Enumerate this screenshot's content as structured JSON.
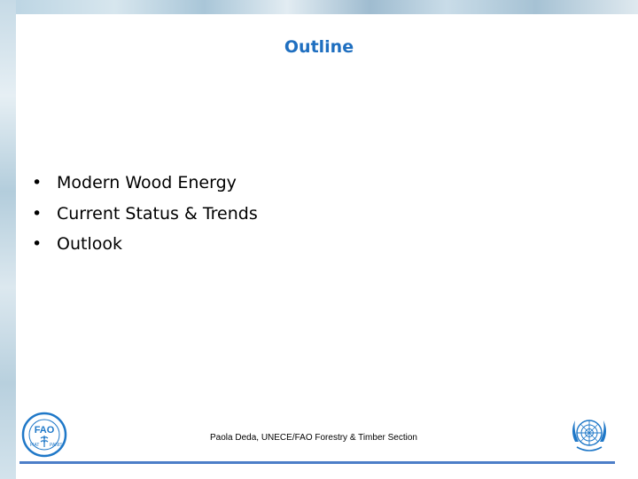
{
  "slide": {
    "title": "Outline",
    "bullets": [
      {
        "marker": "•",
        "text": "Modern Wood Energy"
      },
      {
        "marker": "•",
        "text": "Current Status & Trends"
      },
      {
        "marker": "•",
        "text": "Outlook"
      }
    ],
    "footer_text": "Paola Deda, UNECE/FAO Forestry & Timber Section",
    "logos": {
      "left": {
        "name": "fao-logo-icon",
        "lettering": "FAO FIAT PANIS"
      },
      "right": {
        "name": "un-emblem-icon"
      }
    }
  },
  "colors": {
    "title": "#1f6fc0",
    "footer_rule": "#4d7ec8",
    "logo_blue": "#1f78c8"
  }
}
